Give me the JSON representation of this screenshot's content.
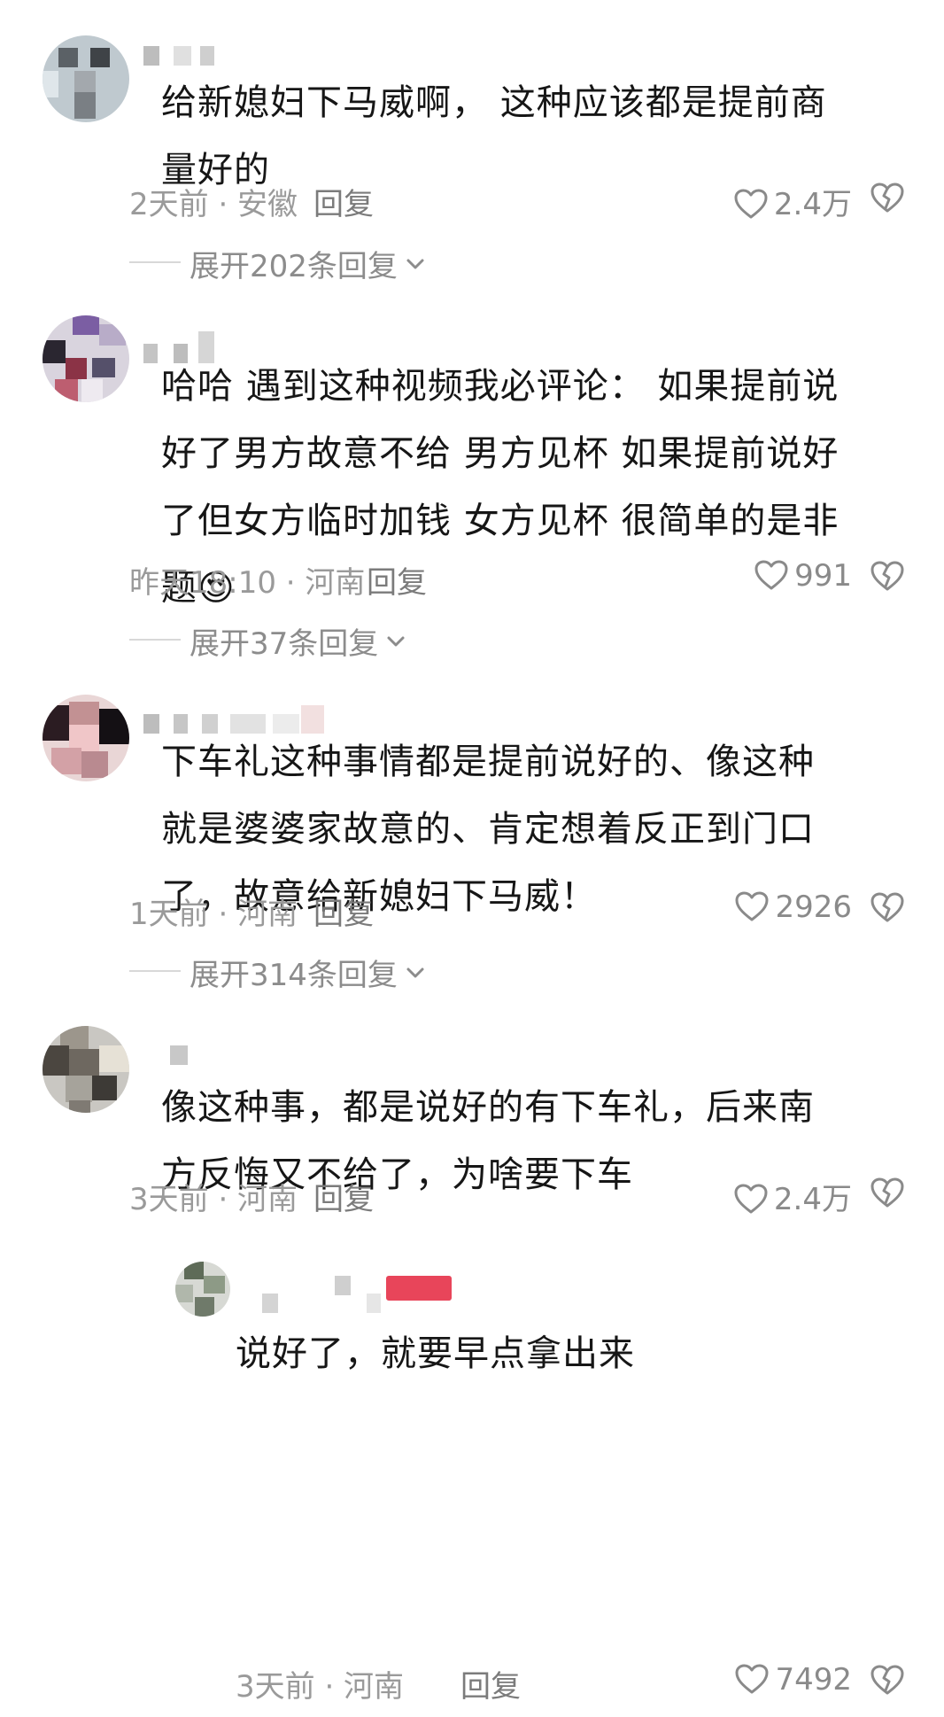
{
  "comments": [
    {
      "text_line1": "给新媳妇下马威啊， 这种应该都是提前商",
      "text_line2": "量好的",
      "time_location": "2天前 · 安徽",
      "reply_label": "回复",
      "likes": "2.4万",
      "expand_label": "展开202条回复"
    },
    {
      "text_line1": "哈哈 遇到这种视频我必评论： 如果提前说",
      "text_line2": "好了男方故意不给 男方见杯 如果提前说好",
      "text_line3": "了但女方临时加钱 女方见杯 很简单的是非",
      "text_line4": "题",
      "emoji": "😍",
      "time_location": "昨天18:10 · 河南",
      "reply_label": "回复",
      "likes": "991",
      "expand_label": "展开37条回复"
    },
    {
      "text_line1": "下车礼这种事情都是提前说好的、像这种",
      "text_line2": "就是婆婆家故意的、肯定想着反正到门口",
      "text_line3": "了，故意给新媳妇下马威！",
      "time_location": "1天前 · 河南",
      "reply_label": "回复",
      "likes": "2926",
      "expand_label": "展开314条回复"
    },
    {
      "text_line1": "像这种事，都是说好的有下车礼，后来南",
      "text_line2": "方反悔又不给了，为啥要下车",
      "time_location": "3天前 · 河南",
      "reply_label": "回复",
      "likes": "2.4万"
    }
  ],
  "reply": {
    "text": "说好了，就要早点拿出来",
    "time_location": "3天前 · 河南",
    "reply_label": "回复",
    "likes": "7492"
  },
  "icons": {
    "like": "heart-outline-icon",
    "dislike": "broken-heart-icon",
    "expand": "chevron-down-icon"
  },
  "colors": {
    "text": "#161616",
    "meta": "#9a9a9a",
    "icon": "#8a8a8a",
    "badge": "#e8455a"
  }
}
